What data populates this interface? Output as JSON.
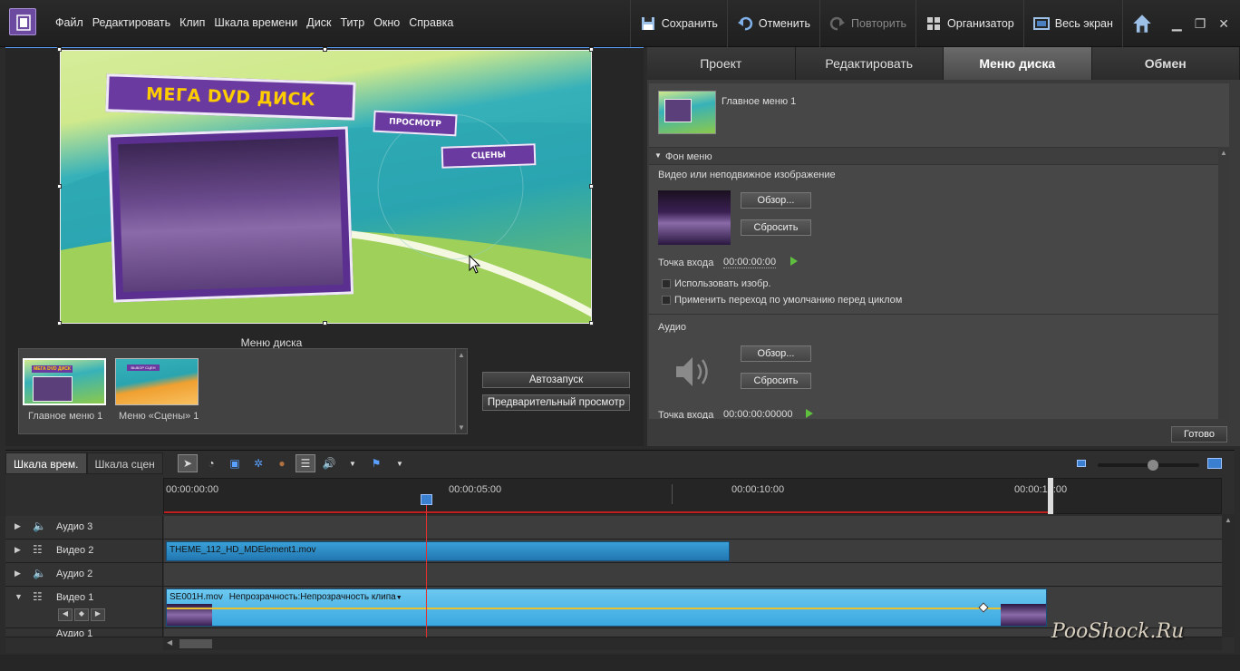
{
  "menubar": {
    "items": [
      "Файл",
      "Редактировать",
      "Клип",
      "Шкала времени",
      "Диск",
      "Титр",
      "Окно",
      "Справка"
    ],
    "buttons": {
      "save": "Сохранить",
      "undo": "Отменить",
      "redo": "Повторить",
      "organizer": "Организатор",
      "fullscreen": "Весь экран"
    }
  },
  "monitor": {
    "menu_title": "МЕГА DVD ДИСК",
    "btn_preview": "ПРОСМОТР",
    "btn_scenes": "СЦЕНЫ",
    "panel_label": "Меню диска",
    "thumb_title_mini": "МЕГА DVD ДИСК",
    "thumb_scenes_mini": "ВЫБОР СЦЕН",
    "thumbs": [
      {
        "label": "Главное меню 1"
      },
      {
        "label": "Меню «Сцены» 1"
      }
    ],
    "autoplay": "Автозапуск",
    "preview_btn": "Предварительный просмотр"
  },
  "right_panel": {
    "tabs": [
      "Проект",
      "Редактировать",
      "Меню диска",
      "Обмен"
    ],
    "active_tab": "Меню диска",
    "menu_name": "Главное меню 1",
    "section_title": "Фон меню",
    "video_label": "Видео или неподвижное изображение",
    "browse": "Обзор...",
    "reset": "Сбросить",
    "in_point_label": "Точка входа",
    "in_point_value": "00:00:00:00",
    "use_image": "Использовать изобр.",
    "apply_transition": "Применить переход по умолчанию перед циклом",
    "audio_label": "Аудио",
    "audio_in_point_value": "00:00:00:00000",
    "done": "Готово"
  },
  "timeline": {
    "tabs": [
      "Шкала врем.",
      "Шкала сцен"
    ],
    "ruler": [
      "00:00:00:00",
      "00:00:05:00",
      "00:00:10:00",
      "00:00:15:00"
    ],
    "tracks": [
      {
        "name": "Аудио 3"
      },
      {
        "name": "Видео 2"
      },
      {
        "name": "Аудио 2"
      },
      {
        "name": "Видео 1"
      },
      {
        "name": "Аудио 1"
      }
    ],
    "clip_v2": "THEME_112_HD_MDElement1.mov",
    "clip_v1_name": "SE001H.mov",
    "clip_v1_opacity": "Непрозрачность:Непрозрачность клипа"
  },
  "watermark": "PooShock.Ru",
  "colors": {
    "accent_purple": "#6a3aa0",
    "title_yellow": "#ffcc00",
    "clip_blue": "#3aa0d8",
    "playhead_red": "#e03030"
  }
}
